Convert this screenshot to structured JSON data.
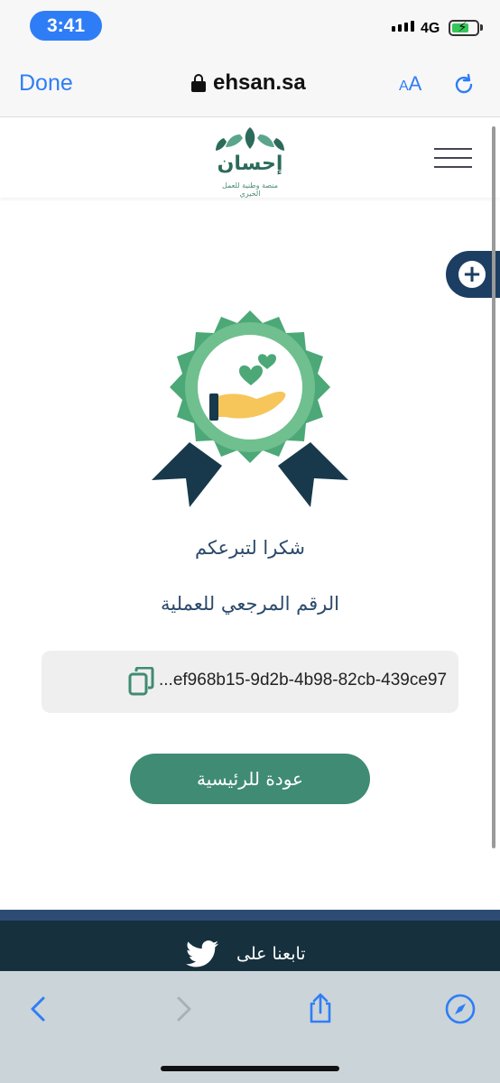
{
  "status_bar": {
    "time": "3:41",
    "network": "4G"
  },
  "browser": {
    "done_label": "Done",
    "url": "ehsan.sa",
    "aa_small": "A",
    "aa_large": "A"
  },
  "site": {
    "logo_name": "إحسان",
    "logo_tagline": "منصة وطنية للعمل الخيري"
  },
  "main": {
    "thanks_text": "شكرا لتبرعكم",
    "reference_label": "الرقم المرجعي للعملية",
    "reference_value": "...ef968b15-9d2b-4b98-82cb-439ce97",
    "home_button_label": "عودة للرئيسية"
  },
  "footer": {
    "follow_text": "تابعنا على"
  },
  "colors": {
    "accent_blue": "#2f7df6",
    "brand_green": "#3f8b73",
    "navy": "#1d3e63",
    "footer_dark": "#16303e"
  }
}
